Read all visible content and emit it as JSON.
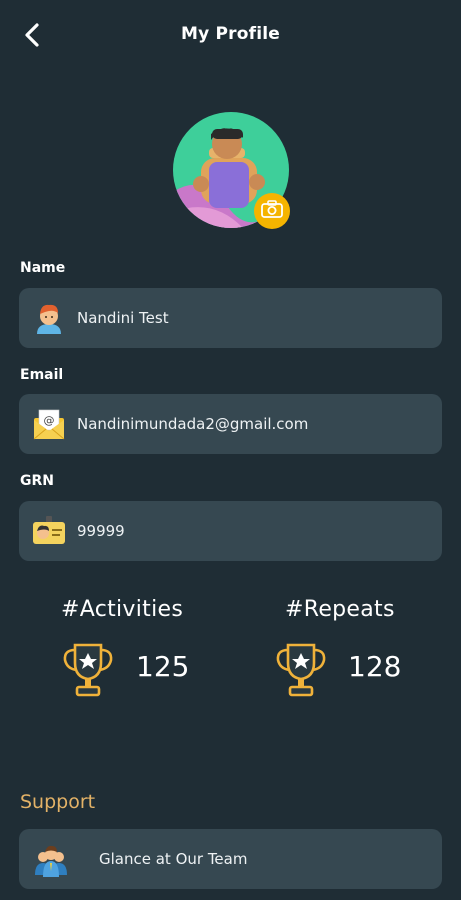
{
  "header": {
    "title": "My Profile"
  },
  "profile": {
    "fields": [
      {
        "label": "Name",
        "value": "Nandini Test",
        "icon": "person-avatar-icon"
      },
      {
        "label": "Email",
        "value": "Nandinimundada2@gmail.com",
        "icon": "mail-envelope-icon"
      },
      {
        "label": "GRN",
        "value": "99999",
        "icon": "id-card-icon"
      }
    ]
  },
  "stats": {
    "activities": {
      "label": "#Activities",
      "value": "125",
      "icon": "trophy-icon"
    },
    "repeats": {
      "label": "#Repeats",
      "value": "128",
      "icon": "trophy-icon"
    }
  },
  "support": {
    "title": "Support",
    "items": [
      {
        "label": "Glance at Our Team",
        "icon": "team-icon"
      }
    ]
  },
  "colors": {
    "background": "#1f2d35",
    "card": "#364851",
    "accent_gold": "#f5b400",
    "support_title": "#e3b267"
  }
}
